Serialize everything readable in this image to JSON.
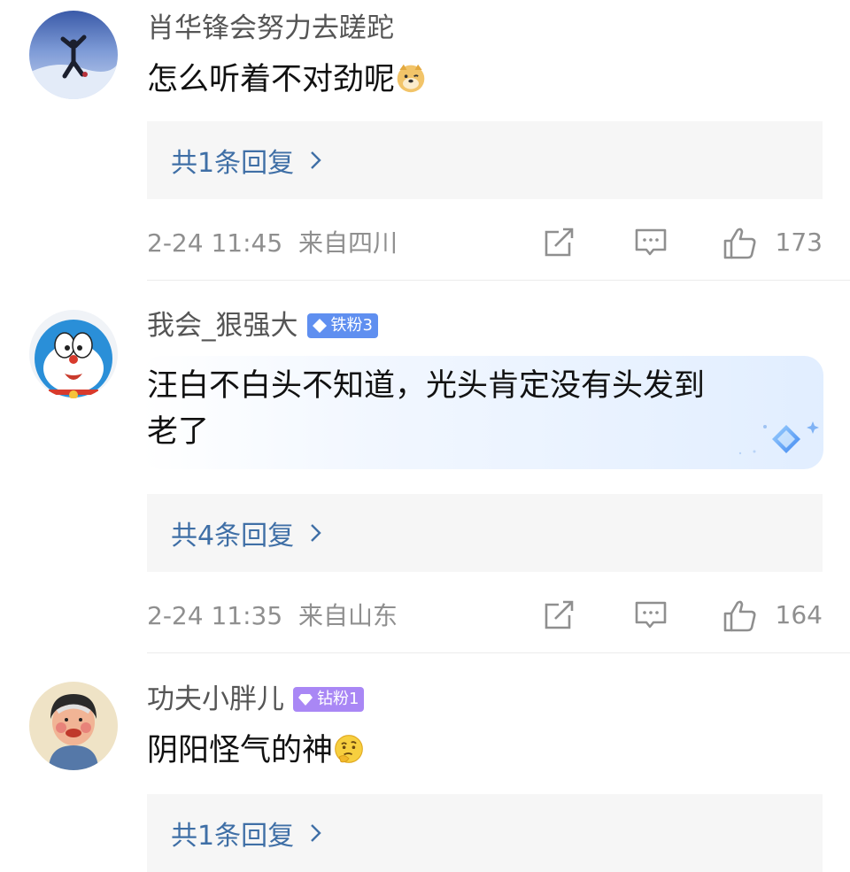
{
  "comments": [
    {
      "username": "肖华锋会努力去蹉跎",
      "content": "怎么听着不对劲呢",
      "emoji": "doge-emoji",
      "replies": "共1条回复",
      "time": "2-24 11:45",
      "location": "来自四川",
      "likes": "173"
    },
    {
      "username": "我会_狠强大",
      "badge": "铁粉3",
      "badge_color": "#5f8ff0",
      "content_line1": "汪白不白头不知道，光头肯定没有头发到",
      "content_line2": "老了",
      "replies": "共4条回复",
      "time": "2-24 11:35",
      "location": "来自山东",
      "likes": "164"
    },
    {
      "username": "功夫小胖儿",
      "badge": "钻粉1",
      "badge_color": "#a987f5",
      "content": "阴阳怪气的神",
      "emoji": "thinking-emoji",
      "replies": "共1条回复"
    }
  ],
  "colors": {
    "reply_link": "#3f6fa6",
    "meta_text": "#8f8f8f",
    "username": "#555555"
  },
  "icons": [
    "share-icon",
    "comment-icon",
    "like-icon",
    "chevron-right-icon"
  ]
}
